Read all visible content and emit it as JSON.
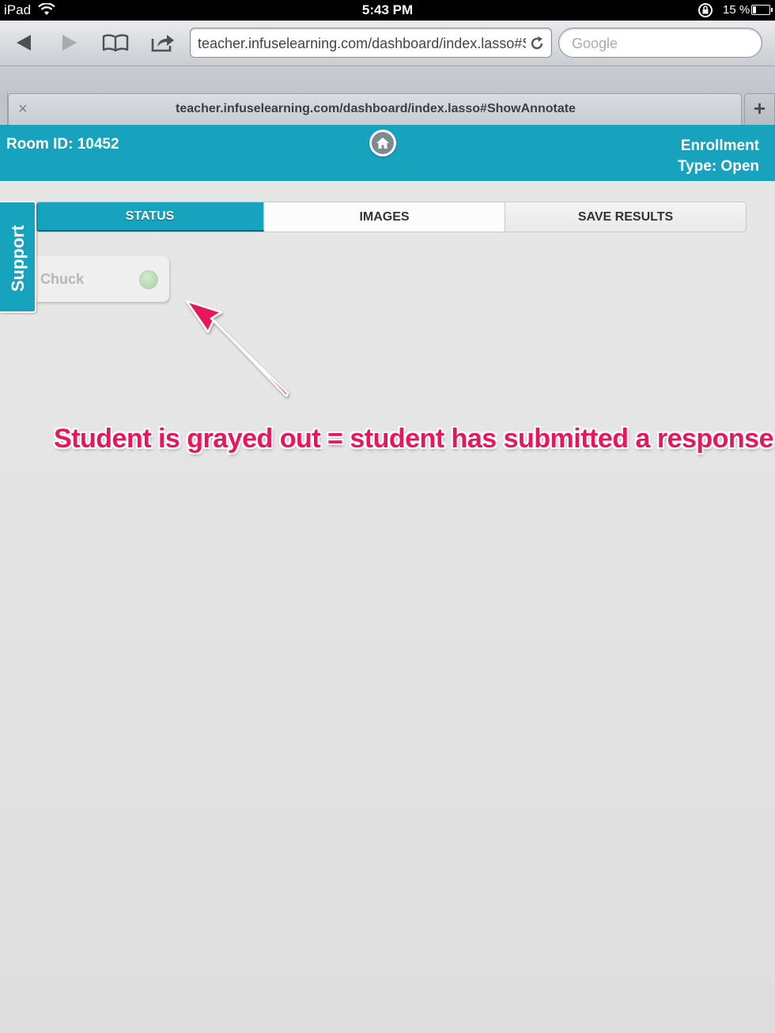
{
  "status_bar": {
    "device": "iPad",
    "time": "5:43 PM",
    "battery": "15 %"
  },
  "browser": {
    "url": "teacher.infuselearning.com/dashboard/index.lasso#ShowAnnotate",
    "search_placeholder": "Google",
    "tab_title": "teacher.infuselearning.com/dashboard/index.lasso#ShowAnnotate",
    "close_tab_glyph": "×",
    "new_tab_glyph": "+"
  },
  "header": {
    "room_id": "Room ID: 10452",
    "enrollment_line1": "Enrollment",
    "enrollment_line2": "Type: Open",
    "accent_color": "#17a2bd"
  },
  "tabs": [
    {
      "label": "STATUS",
      "active": true
    },
    {
      "label": "IMAGES",
      "active": false
    },
    {
      "label": "SAVE RESULTS",
      "active": false
    }
  ],
  "support_label": "Support",
  "students": [
    {
      "name": "Chuck",
      "status": "submitted"
    }
  ],
  "annotation": {
    "text": "Student is grayed out = student has submitted a response",
    "color": "#e8175d"
  }
}
